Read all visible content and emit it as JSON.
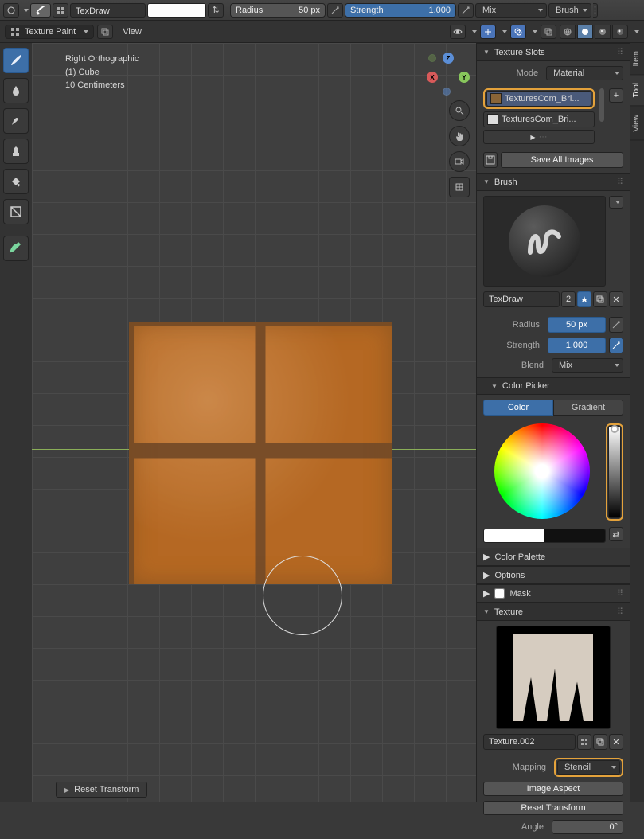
{
  "topbar": {
    "brush_name": "TexDraw",
    "radius_label": "Radius",
    "radius_value": "50 px",
    "strength_label": "Strength",
    "strength_value": "1.000",
    "blend_label": "Mix",
    "brush_drop": "Brush"
  },
  "secondbar": {
    "mode": "Texture Paint",
    "view_menu": "View"
  },
  "vpinfo": {
    "view": "Right Orthographic",
    "object": "(1)  Cube",
    "scale": "10 Centimeters"
  },
  "bottom": {
    "reset": "Reset Transform"
  },
  "tabs": {
    "item": "Item",
    "tool": "Tool",
    "view": "View"
  },
  "tex_slots": {
    "title": "Texture Slots",
    "mode_label": "Mode",
    "mode_value": "Material",
    "items": [
      "TexturesCom_Bri...",
      "TexturesCom_Bri..."
    ],
    "save_all": "Save All Images"
  },
  "brush": {
    "title": "Brush",
    "name": "TexDraw",
    "users": "2",
    "radius_label": "Radius",
    "radius_value": "50 px",
    "strength_label": "Strength",
    "strength_value": "1.000",
    "blend_label": "Blend",
    "blend_value": "Mix"
  },
  "color_picker": {
    "title": "Color Picker",
    "color_tab": "Color",
    "gradient_tab": "Gradient"
  },
  "sections": {
    "palette": "Color Palette",
    "options": "Options",
    "mask": "Mask"
  },
  "texture": {
    "title": "Texture",
    "name": "Texture.002",
    "mapping_label": "Mapping",
    "mapping_value": "Stencil",
    "image_aspect": "Image Aspect",
    "reset_transform": "Reset Transform",
    "angle_label": "Angle",
    "angle_value": "0°"
  }
}
